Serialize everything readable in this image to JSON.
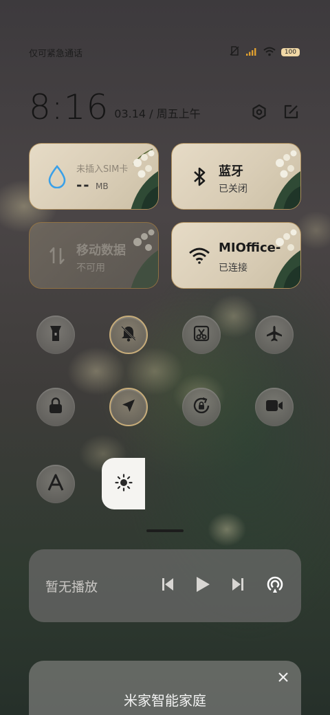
{
  "status_bar": {
    "carrier_text": "仅可紧急通话",
    "battery": "100",
    "icons": [
      "no-sim-icon",
      "signal-icon",
      "wifi-icon",
      "battery-icon"
    ]
  },
  "header": {
    "time": "8:16",
    "date": "03.14 / 周五上午",
    "settings_icon": "settings-icon",
    "edit_icon": "edit-icon"
  },
  "tiles": [
    {
      "title": "未插入SIM卡",
      "value": "--",
      "unit": "MB",
      "icon": "water-drop-icon",
      "active": true
    },
    {
      "title": "蓝牙",
      "subtitle": "已关闭",
      "icon": "bluetooth-icon",
      "active": true
    },
    {
      "title": "移动数据",
      "subtitle": "不可用",
      "icon": "mobile-data-icon",
      "active": false
    },
    {
      "title": "MIOffice-",
      "subtitle": "已连接",
      "icon": "wifi-icon",
      "active": true
    }
  ],
  "toggles": [
    {
      "name": "flashlight",
      "icon": "flashlight-icon",
      "on": false
    },
    {
      "name": "mute",
      "icon": "bell-off-icon",
      "on": true
    },
    {
      "name": "screenshot",
      "icon": "screenshot-icon",
      "on": false
    },
    {
      "name": "airplane",
      "icon": "airplane-icon",
      "on": false
    },
    {
      "name": "lock",
      "icon": "lock-icon",
      "on": false
    },
    {
      "name": "location",
      "icon": "location-icon",
      "on": true
    },
    {
      "name": "auto-rotate",
      "icon": "rotate-lock-icon",
      "on": false
    },
    {
      "name": "screen-record",
      "icon": "video-icon",
      "on": false
    },
    {
      "name": "font",
      "icon": "font-a-icon",
      "on": false
    }
  ],
  "brightness": {
    "icon": "sun-icon"
  },
  "media": {
    "label": "暂无播放",
    "controls": [
      "previous-icon",
      "play-icon",
      "next-icon",
      "cast-icon"
    ]
  },
  "card": {
    "title": "米家智能家庭",
    "subtitle": "",
    "close_icon": "close-icon"
  },
  "colors": {
    "tile_border": "#a0783c",
    "tile_bg": "#e6dbc6",
    "toggle_on_ring": "#c8ad7a",
    "wifi_blue": "#3aa0e8"
  }
}
